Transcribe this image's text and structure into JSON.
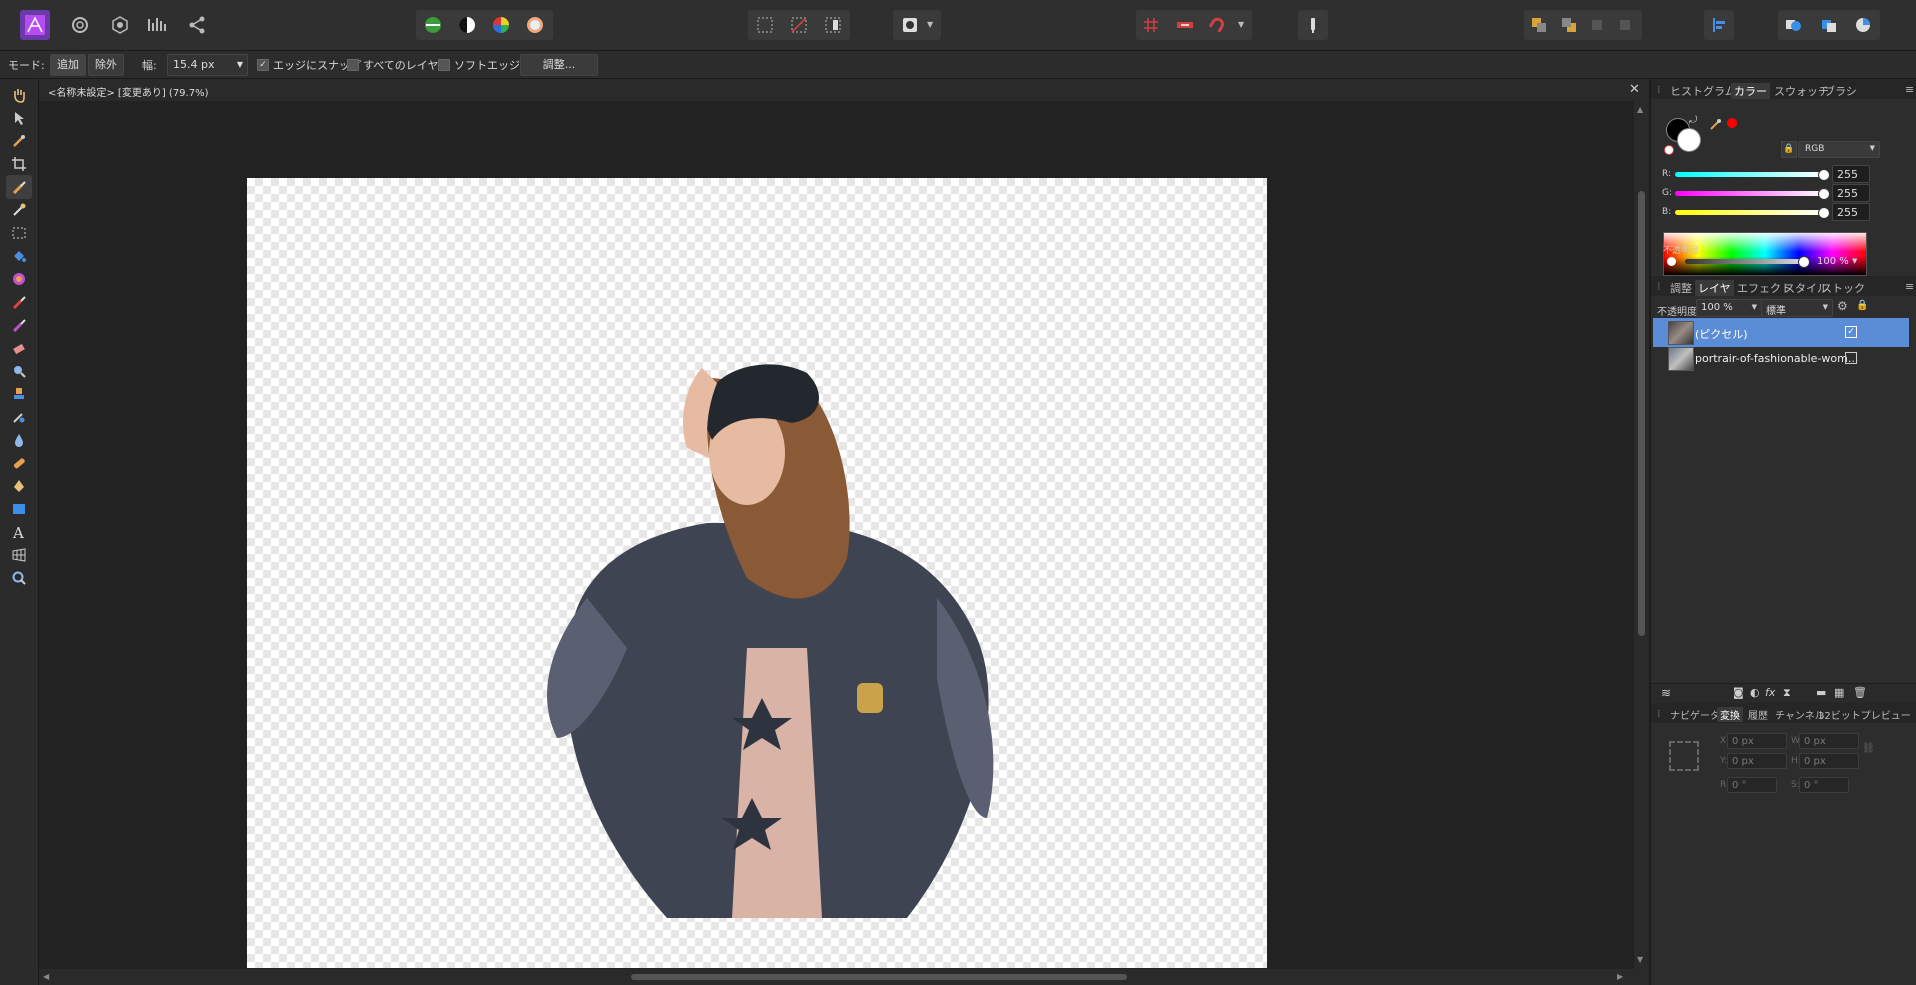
{
  "top_toolbar": {
    "persona_icons": [
      "photo-persona-icon",
      "liquify-persona-icon",
      "develop-persona-icon",
      "tone-mapping-persona-icon",
      "export-persona-icon"
    ],
    "colors": {
      "accent": "#5b8dd6",
      "brand": "#b84cf2",
      "selected_layer": "#5b8dd6",
      "bg": "#1e1e1e"
    }
  },
  "context_bar": {
    "mode_label": "モード:",
    "add_label": "追加",
    "subtract_label": "除外",
    "width_label": "幅:",
    "width_value": "15.4 px",
    "snap_edges_label": "エッジにスナップ",
    "snap_edges_checked": true,
    "all_layers_label": "すべてのレイヤー",
    "all_layers_checked": false,
    "soft_edge_label": "ソフトエッジ",
    "soft_edge_checked": false,
    "refine_label": "調整..."
  },
  "document": {
    "title": "<名称未設定> [変更あり] (79.7%)"
  },
  "color_panel": {
    "tabs": [
      "ヒストグラム",
      "カラー",
      "スウォッチ",
      "ブラシ"
    ],
    "active_tab": "カラー",
    "model": "RGB",
    "channels": [
      {
        "label": "R:",
        "value": "255"
      },
      {
        "label": "G:",
        "value": "255"
      },
      {
        "label": "B:",
        "value": "255"
      }
    ],
    "opacity_label": "不透明度",
    "opacity_value": "100 %"
  },
  "layers_panel": {
    "tabs": [
      "調整",
      "レイヤ",
      "エフェクト",
      "スタイル",
      "ストック"
    ],
    "active_tab": "レイヤ",
    "opacity_label": "不透明度:",
    "opacity_value": "100 %",
    "blend_mode": "標準",
    "layers": [
      {
        "name": "(ピクセル)",
        "visible": true,
        "selected": true
      },
      {
        "name": "portrair-of-fashionable-wom...",
        "visible": false,
        "selected": false
      }
    ]
  },
  "transform_panel": {
    "tabs": [
      "ナビゲータ",
      "変換",
      "履歴",
      "チャンネル",
      "32ビットプレビュー"
    ],
    "active_tab": "変換",
    "fields": {
      "x_label": "X:",
      "x": "0 px",
      "w_label": "W:",
      "w": "0 px",
      "y_label": "Y:",
      "y": "0 px",
      "h_label": "H:",
      "h": "0 px",
      "r_label": "R:",
      "r": "0 °",
      "s_label": "S:",
      "s": "0 °"
    }
  }
}
